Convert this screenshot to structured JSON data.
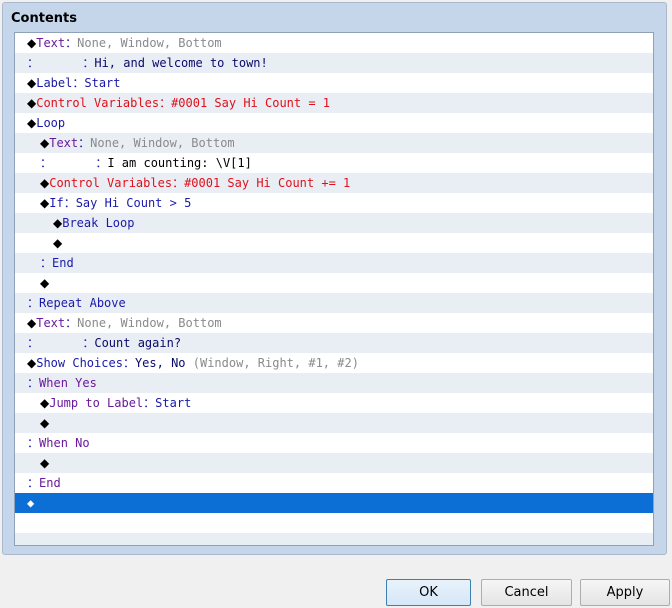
{
  "group_title": "Contents",
  "rows": [
    {
      "indent": 0,
      "parts": [
        {
          "t": "◆",
          "c": "dia"
        },
        {
          "t": "Text",
          "c": "c-purple"
        },
        {
          "t": "：",
          "c": "c-blue"
        },
        {
          "t": "None, Window, Bottom",
          "c": "c-gray"
        }
      ]
    },
    {
      "indent": 0,
      "parts": [
        {
          "t": "：      ：",
          "c": "c-blue"
        },
        {
          "t": "Hi, and welcome to town!",
          "c": "c-dark"
        }
      ]
    },
    {
      "indent": 0,
      "parts": [
        {
          "t": "◆",
          "c": "dia"
        },
        {
          "t": "Label",
          "c": "c-blue"
        },
        {
          "t": "：",
          "c": "c-blue"
        },
        {
          "t": "Start",
          "c": "c-blue"
        }
      ]
    },
    {
      "indent": 0,
      "parts": [
        {
          "t": "◆",
          "c": "dia"
        },
        {
          "t": "Control Variables",
          "c": "c-red"
        },
        {
          "t": "：",
          "c": "c-red"
        },
        {
          "t": "#0001 Say Hi Count = 1",
          "c": "c-red"
        }
      ]
    },
    {
      "indent": 0,
      "parts": [
        {
          "t": "◆",
          "c": "dia"
        },
        {
          "t": "Loop",
          "c": "c-blue"
        }
      ]
    },
    {
      "indent": 1,
      "parts": [
        {
          "t": "◆",
          "c": "dia"
        },
        {
          "t": "Text",
          "c": "c-purple"
        },
        {
          "t": "：",
          "c": "c-blue"
        },
        {
          "t": "None, Window, Bottom",
          "c": "c-gray"
        }
      ]
    },
    {
      "indent": 1,
      "parts": [
        {
          "t": "：      ：",
          "c": "c-blue"
        },
        {
          "t": "I am counting: \\V[1]",
          "c": "c-black"
        }
      ]
    },
    {
      "indent": 1,
      "parts": [
        {
          "t": "◆",
          "c": "dia"
        },
        {
          "t": "Control Variables",
          "c": "c-red"
        },
        {
          "t": "：",
          "c": "c-red"
        },
        {
          "t": "#0001 Say Hi Count += 1",
          "c": "c-red"
        }
      ]
    },
    {
      "indent": 1,
      "parts": [
        {
          "t": "◆",
          "c": "dia"
        },
        {
          "t": "If",
          "c": "c-blue"
        },
        {
          "t": "：",
          "c": "c-blue"
        },
        {
          "t": "Say Hi Count > 5",
          "c": "c-blue"
        }
      ]
    },
    {
      "indent": 2,
      "parts": [
        {
          "t": "◆",
          "c": "dia"
        },
        {
          "t": "Break Loop",
          "c": "c-blue"
        }
      ]
    },
    {
      "indent": 2,
      "parts": [
        {
          "t": "◆",
          "c": "dia"
        }
      ]
    },
    {
      "indent": 1,
      "parts": [
        {
          "t": "：",
          "c": "c-blue"
        },
        {
          "t": "End",
          "c": "c-blue"
        }
      ]
    },
    {
      "indent": 1,
      "parts": [
        {
          "t": "◆",
          "c": "dia"
        }
      ]
    },
    {
      "indent": 0,
      "parts": [
        {
          "t": "：",
          "c": "c-blue"
        },
        {
          "t": "Repeat Above",
          "c": "c-blue"
        }
      ]
    },
    {
      "indent": 0,
      "parts": [
        {
          "t": "◆",
          "c": "dia"
        },
        {
          "t": "Text",
          "c": "c-purple"
        },
        {
          "t": "：",
          "c": "c-blue"
        },
        {
          "t": "None, Window, Bottom",
          "c": "c-gray"
        }
      ]
    },
    {
      "indent": 0,
      "parts": [
        {
          "t": "：      ：",
          "c": "c-blue"
        },
        {
          "t": "Count again?",
          "c": "c-dark"
        }
      ]
    },
    {
      "indent": 0,
      "parts": [
        {
          "t": "◆",
          "c": "dia"
        },
        {
          "t": "Show Choices",
          "c": "c-blue"
        },
        {
          "t": "：",
          "c": "c-blue"
        },
        {
          "t": "Yes, No",
          "c": "c-dark"
        },
        {
          "t": " (Window, Right, #1, #2)",
          "c": "c-gray"
        }
      ]
    },
    {
      "indent": 0,
      "parts": [
        {
          "t": "：",
          "c": "c-blue"
        },
        {
          "t": "When Yes",
          "c": "c-purple"
        }
      ]
    },
    {
      "indent": 1,
      "parts": [
        {
          "t": "◆",
          "c": "dia"
        },
        {
          "t": "Jump to Label",
          "c": "c-purple"
        },
        {
          "t": "：",
          "c": "c-blue"
        },
        {
          "t": "Start",
          "c": "c-blue"
        }
      ]
    },
    {
      "indent": 1,
      "parts": [
        {
          "t": "◆",
          "c": "dia"
        }
      ]
    },
    {
      "indent": 0,
      "parts": [
        {
          "t": "：",
          "c": "c-blue"
        },
        {
          "t": "When No",
          "c": "c-purple"
        }
      ]
    },
    {
      "indent": 1,
      "parts": [
        {
          "t": "◆",
          "c": "dia"
        }
      ]
    },
    {
      "indent": 0,
      "parts": [
        {
          "t": "：",
          "c": "c-blue"
        },
        {
          "t": "End",
          "c": "c-purple"
        }
      ]
    },
    {
      "indent": 0,
      "selected": true,
      "parts": [
        {
          "t": "◆",
          "c": "dia-white"
        }
      ]
    },
    {
      "indent": 0,
      "parts": []
    },
    {
      "indent": 0,
      "parts": []
    }
  ],
  "buttons": {
    "ok": "OK",
    "cancel": "Cancel",
    "apply": "Apply"
  }
}
